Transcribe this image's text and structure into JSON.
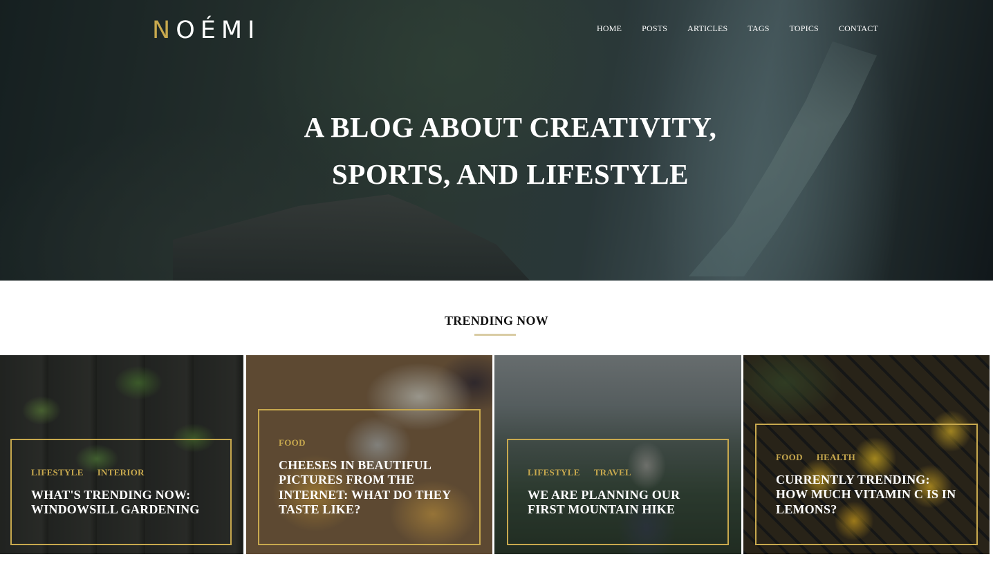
{
  "header": {
    "logo": {
      "accent_letter": "N",
      "rest": "OÉMI"
    },
    "nav": [
      "HOME",
      "POSTS",
      "ARTICLES",
      "TAGS",
      "TOPICS",
      "CONTACT"
    ]
  },
  "hero": {
    "title_line1": "A BLOG ABOUT CREATIVITY,",
    "title_line2": "SPORTS, AND LIFESTYLE"
  },
  "trending": {
    "title": "TRENDING NOW",
    "cards": [
      {
        "tags": [
          "LIFESTYLE",
          "INTERIOR"
        ],
        "title": "WHAT'S TRENDING NOW: WINDOWSILL GARDENING"
      },
      {
        "tags": [
          "FOOD"
        ],
        "title": "CHEESES IN BEAUTIFUL PICTURES FROM THE INTERNET: WHAT DO THEY TASTE LIKE?"
      },
      {
        "tags": [
          "LIFESTYLE",
          "TRAVEL"
        ],
        "title": "WE ARE PLANNING OUR FIRST MOUNTAIN HIKE"
      },
      {
        "tags": [
          "FOOD",
          "HEALTH"
        ],
        "title": "CURRENTLY TRENDING: HOW MUCH VITAMIN C IS IN LEMONS?"
      }
    ]
  },
  "colors": {
    "accent_gold": "#c8a94e",
    "underline": "#d9cca4",
    "text_dark": "#111111"
  }
}
